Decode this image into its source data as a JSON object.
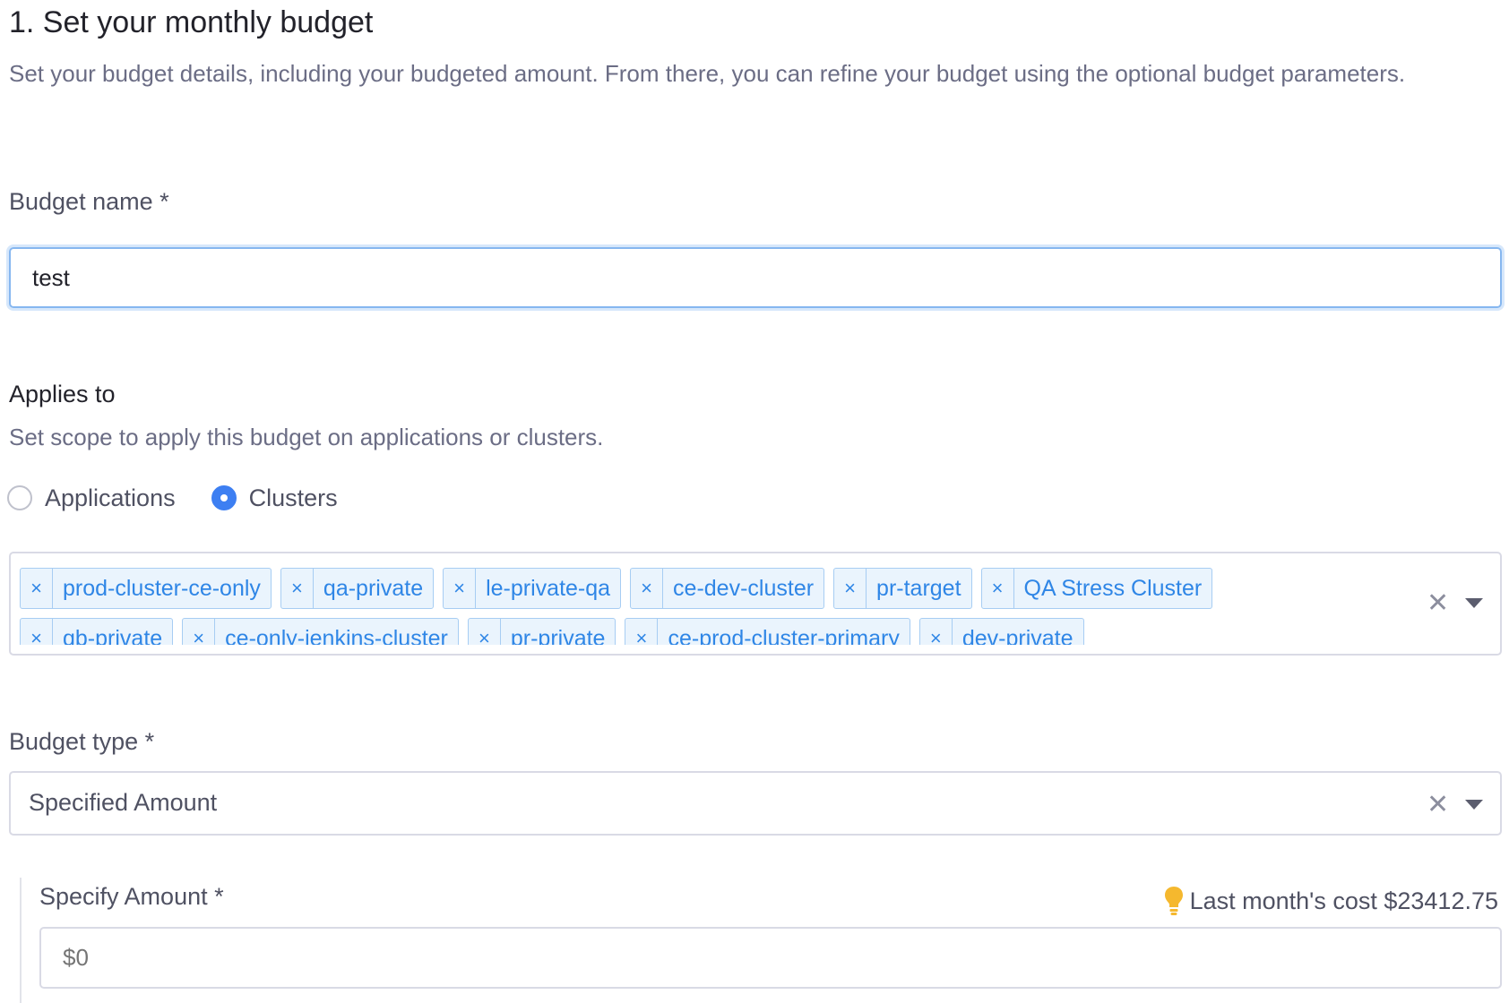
{
  "section": {
    "heading": "1. Set your monthly budget",
    "description": "Set your budget details, including your budgeted amount. From there, you can refine your budget using the optional budget parameters."
  },
  "budget_name": {
    "label": "Budget name *",
    "value": "test"
  },
  "applies_to": {
    "label": "Applies to",
    "description": "Set scope to apply this budget on applications or clusters.",
    "options": [
      {
        "label": "Applications",
        "selected": false
      },
      {
        "label": "Clusters",
        "selected": true
      }
    ],
    "selected_clusters": [
      "prod-cluster-ce-only",
      "qa-private",
      "le-private-qa",
      "ce-dev-cluster",
      "pr-target",
      "QA Stress Cluster",
      "qb-private",
      "ce-only-jenkins-cluster",
      "pr-private",
      "ce-prod-cluster-primary",
      "dev-private"
    ],
    "tag_remove_glyph": "×",
    "clear_glyph": "✕"
  },
  "budget_type": {
    "label": "Budget type *",
    "value": "Specified Amount",
    "clear_glyph": "✕"
  },
  "specify_amount": {
    "label": "Specify Amount *",
    "hint": "Last month's cost $23412.75",
    "hint_icon": "lightbulb-icon",
    "placeholder": "$0"
  },
  "colors": {
    "accent": "#3d7ff2",
    "tag_text": "#2f86e6",
    "tag_bg": "#eaf4fd",
    "bulb": "#f5b82e"
  }
}
